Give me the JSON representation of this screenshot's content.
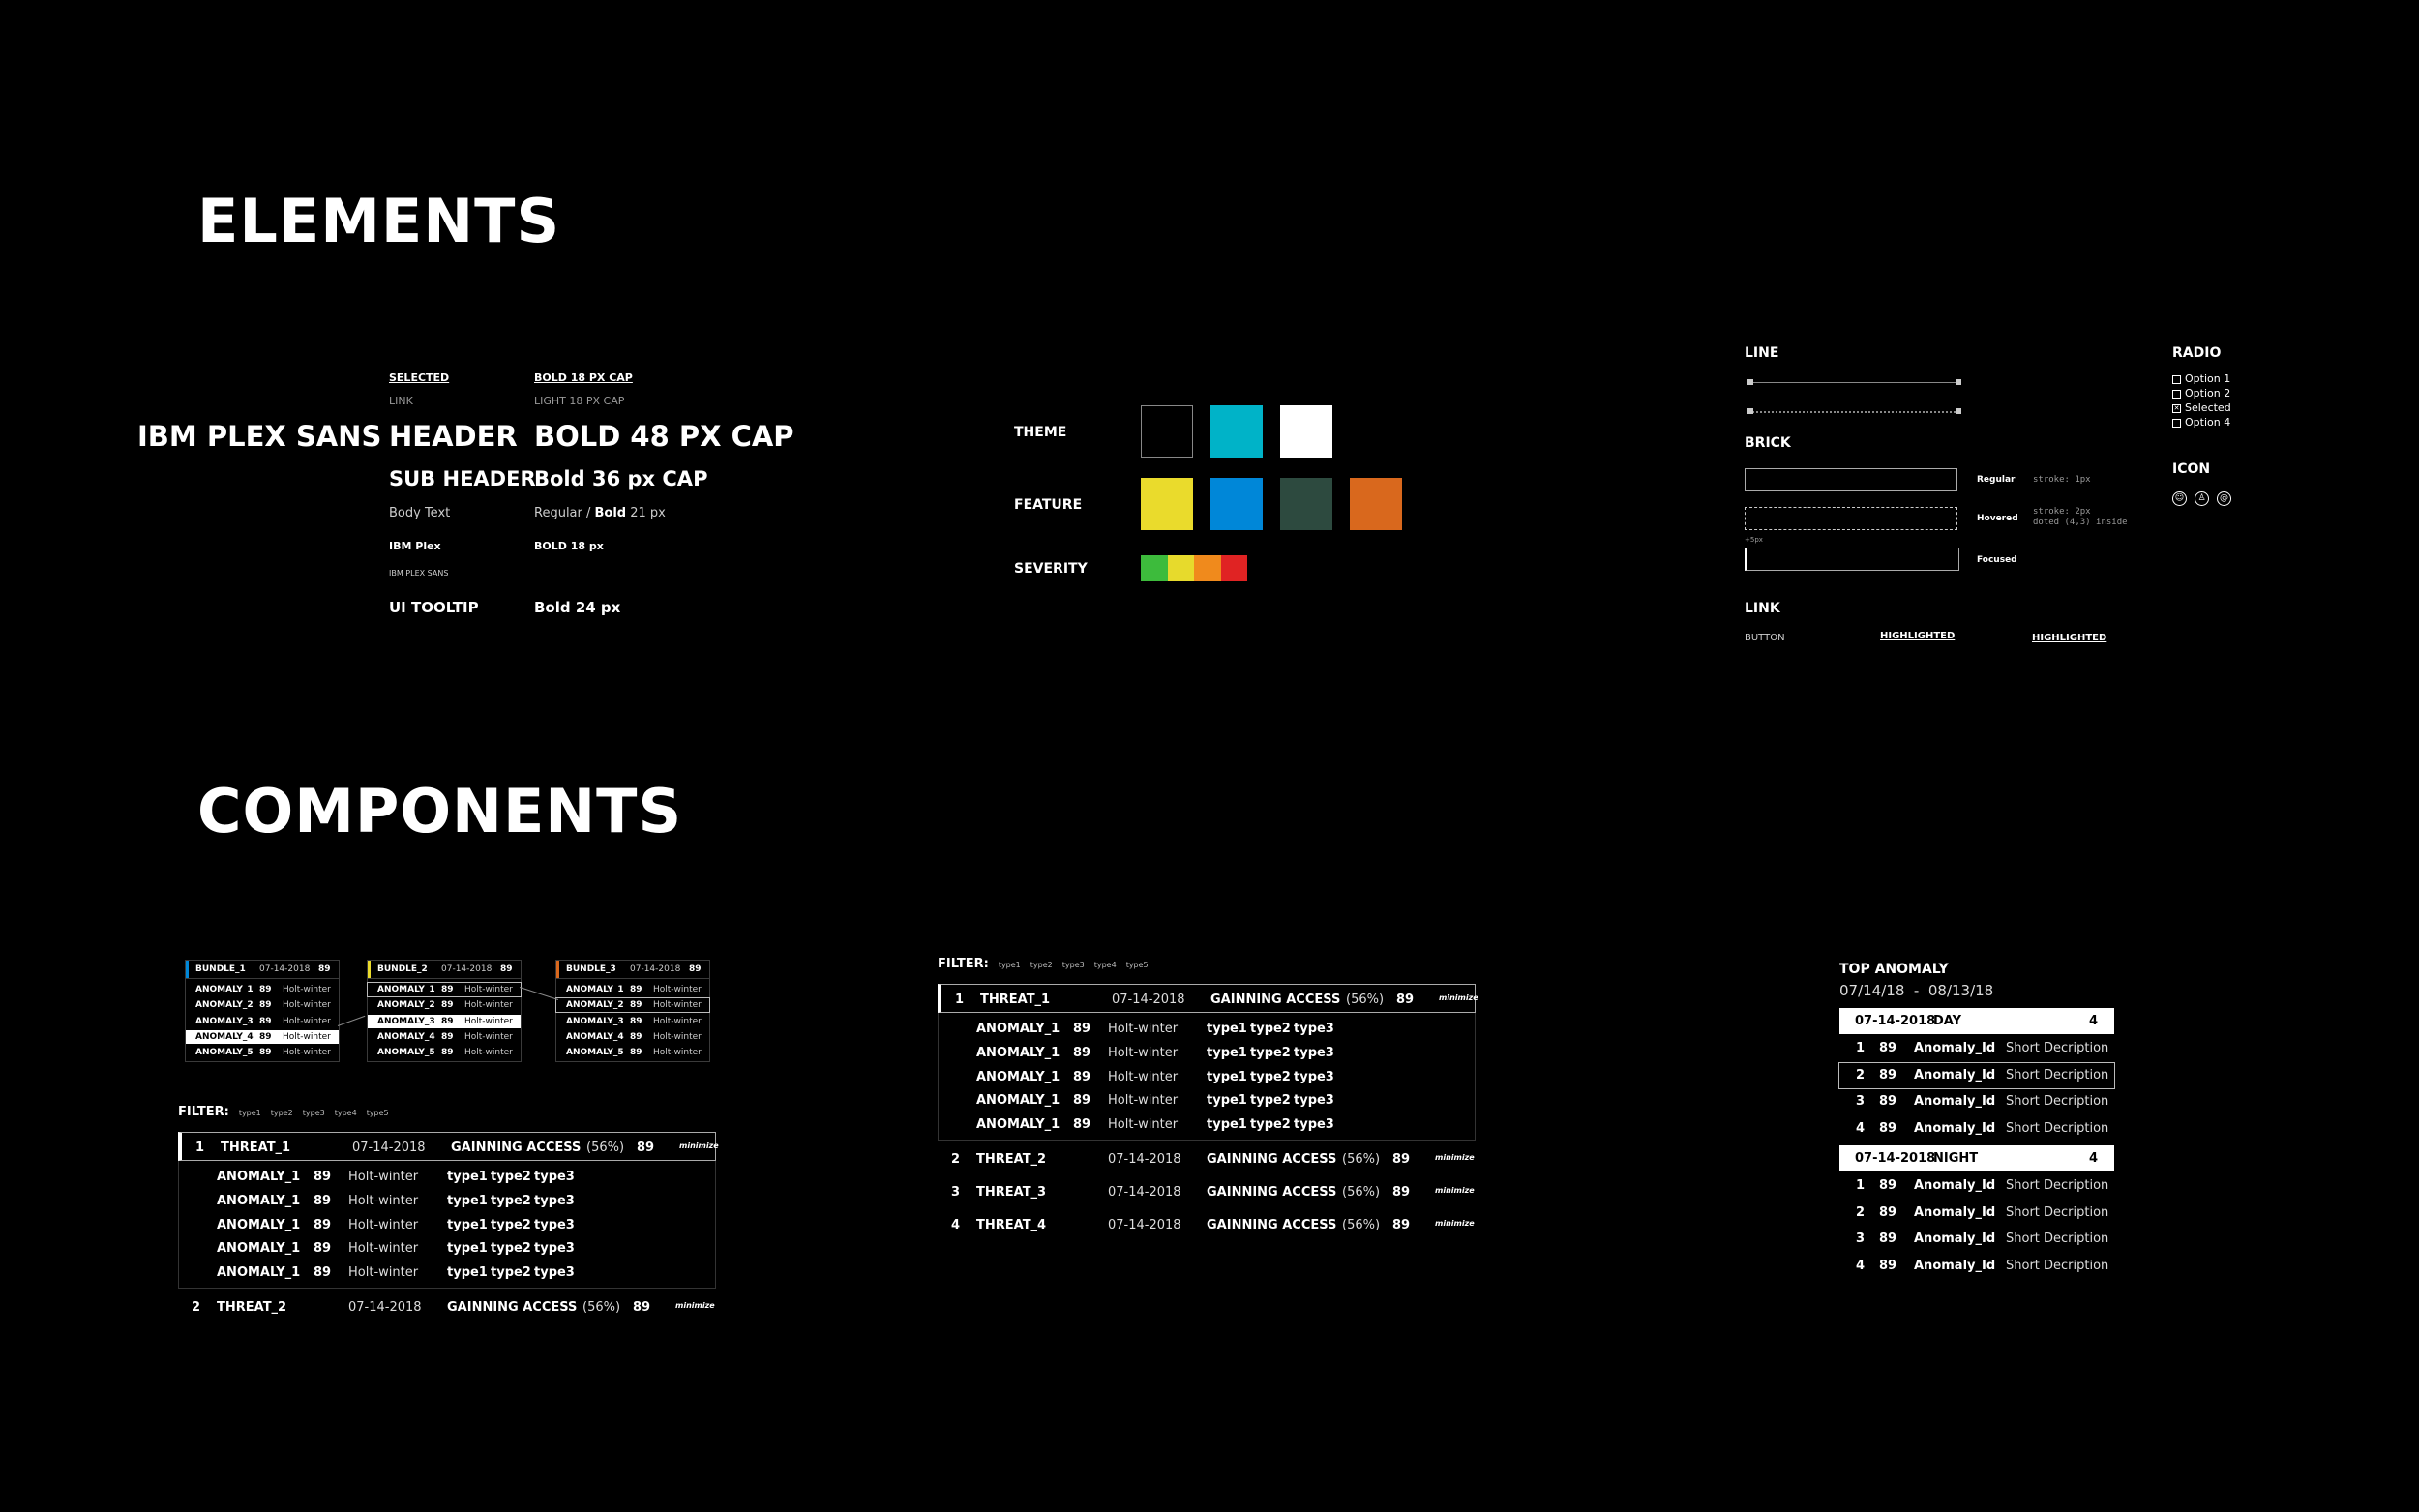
{
  "headings": {
    "elements": "ELEMENTS",
    "components": "COMPONENTS"
  },
  "typography": {
    "font_name": "IBM PLEX SANS",
    "selected": "SELECTED",
    "bold18cap": "BOLD 18 PX CAP",
    "link": "LINK",
    "light18cap": "LIGHT 18 PX CAP",
    "header": "HEADER",
    "bold48": "BOLD 48 PX CAP",
    "subheader": "SUB HEADER",
    "bold36": "Bold 36 px CAP",
    "body_text": "Body Text",
    "regular_bold_a": "Regular / ",
    "regular_bold_b": "Bold",
    "regular_bold_c": " 21 px",
    "ibm_plex": "IBM Plex",
    "bold18": "BOLD 18 px",
    "ibm_plex_sans_small": "IBM PLEX SANS",
    "ui_tooltip": "UI TOOLTIP",
    "bold24": "Bold 24 px"
  },
  "palette": {
    "theme_label": "THEME",
    "feature_label": "FEATURE",
    "severity_label": "SEVERITY",
    "theme": [
      "#000000",
      "#00b3c8",
      "#ffffff"
    ],
    "feature": [
      "#eadb2c",
      "#0087d8",
      "#2d4a3f",
      "#d9681d"
    ],
    "severity": [
      "#3dbb3c",
      "#e7da2c",
      "#f08a1c",
      "#e02323"
    ]
  },
  "ui": {
    "line_label": "LINE",
    "brick_label": "BRICK",
    "brick_regular": "Regular",
    "brick_regular_note": "stroke: 1px",
    "brick_hovered": "Hovered",
    "brick_hovered_note_1": "stroke: 2px",
    "brick_hovered_note_2": "doted (4,3) inside",
    "brick_small": "+5px",
    "brick_focused": "Focused",
    "link_label": "LINK",
    "button": "BUTTON",
    "highlighted_1": "HIGHLIGHTED",
    "highlighted_2": "HIGHLIGHTED",
    "radio_label": "RADIO",
    "radio_options": [
      "Option 1",
      "Option 2",
      "Selected",
      "Option 4"
    ],
    "icon_label": "ICON"
  },
  "bundles": [
    {
      "name": "BUNDLE_1",
      "date": "07-14-2018",
      "score": "89",
      "accent": "#0087d8",
      "rows": [
        [
          "ANOMALY_1",
          "89",
          "Holt-winter"
        ],
        [
          "ANOMALY_2",
          "89",
          "Holt-winter"
        ],
        [
          "ANOMALY_3",
          "89",
          "Holt-winter"
        ],
        [
          "ANOMALY_4",
          "89",
          "Holt-winter"
        ],
        [
          "ANOMALY_5",
          "89",
          "Holt-winter"
        ]
      ]
    },
    {
      "name": "BUNDLE_2",
      "date": "07-14-2018",
      "score": "89",
      "accent": "#eadb2c",
      "rows": [
        [
          "ANOMALY_1",
          "89",
          "Holt-winter"
        ],
        [
          "ANOMALY_2",
          "89",
          "Holt-winter"
        ],
        [
          "ANOMALY_3",
          "89",
          "Holt-winter"
        ],
        [
          "ANOMALY_4",
          "89",
          "Holt-winter"
        ],
        [
          "ANOMALY_5",
          "89",
          "Holt-winter"
        ]
      ]
    },
    {
      "name": "BUNDLE_3",
      "date": "07-14-2018",
      "score": "89",
      "accent": "#d9681d",
      "rows": [
        [
          "ANOMALY_1",
          "89",
          "Holt-winter"
        ],
        [
          "ANOMALY_2",
          "89",
          "Holt-winter"
        ],
        [
          "ANOMALY_3",
          "89",
          "Holt-winter"
        ],
        [
          "ANOMALY_4",
          "89",
          "Holt-winter"
        ],
        [
          "ANOMALY_5",
          "89",
          "Holt-winter"
        ]
      ]
    }
  ],
  "filter": {
    "label": "FILTER:",
    "types": [
      "type1",
      "type2",
      "type3",
      "type4",
      "type5"
    ]
  },
  "threats": {
    "minimize": "minimize",
    "rows": [
      {
        "n": "1",
        "name": "THREAT_1",
        "date": "07-14-2018",
        "status": "GAINNING ACCESS",
        "pct": "(56%)",
        "score": "89"
      },
      {
        "n": "2",
        "name": "THREAT_2",
        "date": "07-14-2018",
        "status": "GAINNING ACCESS",
        "pct": "(56%)",
        "score": "89"
      },
      {
        "n": "3",
        "name": "THREAT_3",
        "date": "07-14-2018",
        "status": "GAINNING ACCESS",
        "pct": "(56%)",
        "score": "89"
      },
      {
        "n": "4",
        "name": "THREAT_4",
        "date": "07-14-2018",
        "status": "GAINNING ACCESS",
        "pct": "(56%)",
        "score": "89"
      }
    ],
    "sub": {
      "name": "ANOMALY_1",
      "score": "89",
      "method": "Holt-winter",
      "t1": "type1",
      "t2": "type2",
      "t3": "type3"
    }
  },
  "top_anomaly": {
    "title": "TOP ANOMALY",
    "range": "07/14/18  -  08/13/18",
    "groups": [
      {
        "date": "07-14-2018",
        "period": "DAY",
        "count": "4",
        "rows": [
          [
            "1",
            "89",
            "Anomaly_Id",
            "Short Decription"
          ],
          [
            "2",
            "89",
            "Anomaly_Id",
            "Short Decription"
          ],
          [
            "3",
            "89",
            "Anomaly_Id",
            "Short Decription"
          ],
          [
            "4",
            "89",
            "Anomaly_Id",
            "Short Decription"
          ]
        ]
      },
      {
        "date": "07-14-2018",
        "period": "NIGHT",
        "count": "4",
        "rows": [
          [
            "1",
            "89",
            "Anomaly_Id",
            "Short Decription"
          ],
          [
            "2",
            "89",
            "Anomaly_Id",
            "Short Decription"
          ],
          [
            "3",
            "89",
            "Anomaly_Id",
            "Short Decription"
          ],
          [
            "4",
            "89",
            "Anomaly_Id",
            "Short Decription"
          ]
        ]
      }
    ]
  }
}
